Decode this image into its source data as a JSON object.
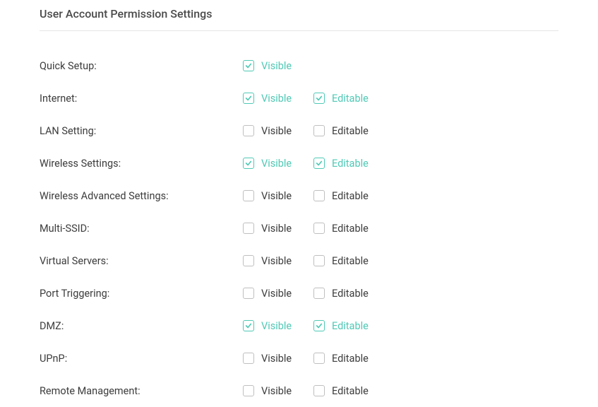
{
  "title": "User Account Permission Settings",
  "labels": {
    "visible": "Visible",
    "editable": "Editable"
  },
  "permissions": [
    {
      "id": "quick-setup",
      "label": "Quick Setup:",
      "visible": true,
      "editable": null
    },
    {
      "id": "internet",
      "label": "Internet:",
      "visible": true,
      "editable": true
    },
    {
      "id": "lan-setting",
      "label": "LAN Setting:",
      "visible": false,
      "editable": false
    },
    {
      "id": "wireless-settings",
      "label": "Wireless Settings:",
      "visible": true,
      "editable": true
    },
    {
      "id": "wireless-advanced-settings",
      "label": "Wireless Advanced Settings:",
      "visible": false,
      "editable": false
    },
    {
      "id": "multi-ssid",
      "label": "Multi-SSID:",
      "visible": false,
      "editable": false
    },
    {
      "id": "virtual-servers",
      "label": "Virtual Servers:",
      "visible": false,
      "editable": false
    },
    {
      "id": "port-triggering",
      "label": "Port Triggering:",
      "visible": false,
      "editable": false
    },
    {
      "id": "dmz",
      "label": "DMZ:",
      "visible": true,
      "editable": true
    },
    {
      "id": "upnp",
      "label": "UPnP:",
      "visible": false,
      "editable": false
    },
    {
      "id": "remote-management",
      "label": "Remote Management:",
      "visible": false,
      "editable": false
    }
  ]
}
